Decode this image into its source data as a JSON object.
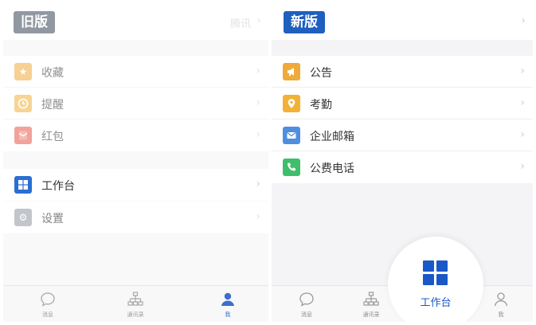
{
  "old_version": {
    "badge": "旧版",
    "header_right": "腾讯",
    "group1": [
      {
        "label": "收藏",
        "icon": "star-icon",
        "color": "#f0a93b"
      },
      {
        "label": "提醒",
        "icon": "clock-icon",
        "color": "#f1b13f"
      },
      {
        "label": "红包",
        "icon": "envelope-icon",
        "color": "#e8574a"
      }
    ],
    "group2": [
      {
        "label": "工作台",
        "icon": "grid-icon",
        "color": "#2a6fd1"
      },
      {
        "label": "设置",
        "icon": "gear-icon",
        "color": "#9aa0a8"
      }
    ],
    "tabs": [
      {
        "label": "消息",
        "icon": "chat-bubble-icon"
      },
      {
        "label": "通讯录",
        "icon": "org-chart-icon"
      },
      {
        "label": "我",
        "icon": "person-icon",
        "active": true
      }
    ]
  },
  "new_version": {
    "badge": "新版",
    "group1": [
      {
        "label": "公告",
        "icon": "megaphone-icon",
        "color": "#f0a93b"
      },
      {
        "label": "考勤",
        "icon": "location-pin-icon",
        "color": "#f2b236"
      },
      {
        "label": "企业邮箱",
        "icon": "mail-icon",
        "color": "#4e8fe0"
      },
      {
        "label": "公费电话",
        "icon": "phone-icon",
        "color": "#3fbf6b"
      }
    ],
    "tabs": [
      {
        "label": "消息",
        "icon": "chat-bubble-icon"
      },
      {
        "label": "通讯录",
        "icon": "org-chart-icon"
      },
      {
        "label": "工作台",
        "icon": "grid-icon",
        "active": true
      },
      {
        "label": "我",
        "icon": "person-icon"
      }
    ]
  }
}
